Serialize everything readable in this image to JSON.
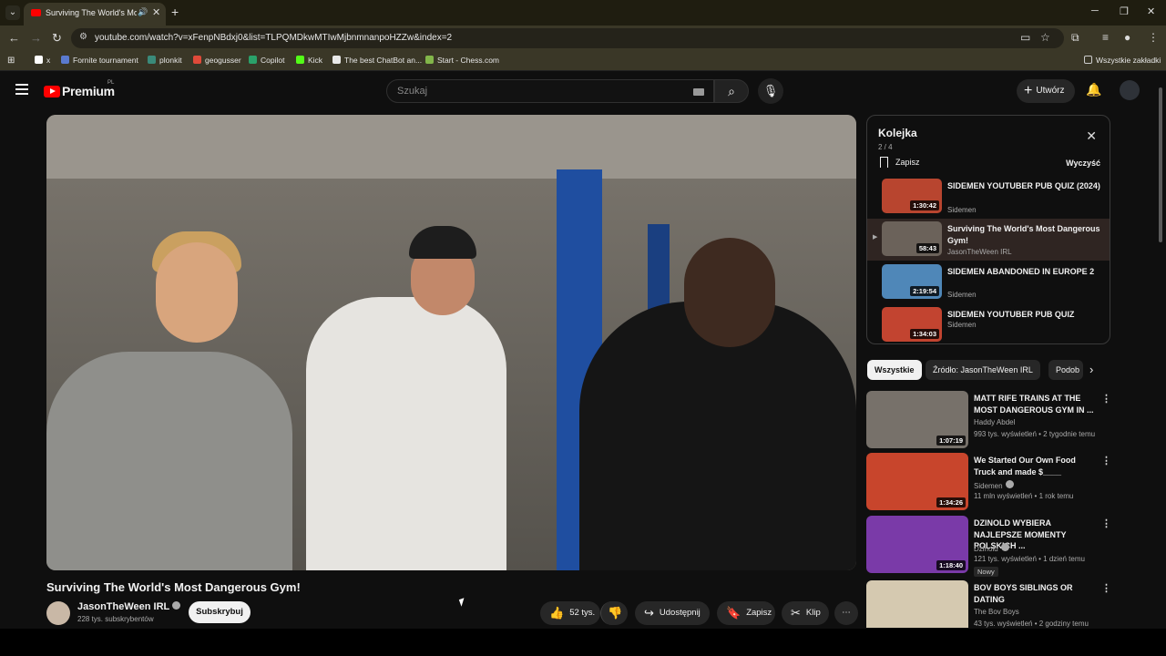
{
  "browser": {
    "tab_title": "Surviving The World's Most",
    "url": "youtube.com/watch?v=xFenpNBdxj0&list=TLPQMDkwMTIwMjbnmnanpoHZZw&index=2",
    "bookmarks": [
      "x",
      "Fornite tournament",
      "plonkit",
      "geogusser",
      "Copilot",
      "Kick",
      "The best ChatBot an...",
      "Start - Chess.com"
    ],
    "bookmark_colors": [
      "#ffffff",
      "#5a7acf",
      "#3a8a7a",
      "#e04a3a",
      "#2aa16a",
      "#53fc18",
      "#e8e8e8",
      "#82b64a"
    ],
    "all_bookmarks": "Wszystkie zakładki"
  },
  "header": {
    "logo": "Premium",
    "logo_region": "PL",
    "search_placeholder": "Szukaj",
    "create_label": "Utwórz"
  },
  "video": {
    "title": "Surviving The World's Most Dangerous Gym!",
    "channel": "JasonTheWeen IRL",
    "subscribers": "228 tys. subskrybentów",
    "subscribe_label": "Subskrybuj",
    "likes": "52 tys.",
    "share_label": "Udostępnij",
    "save_label": "Zapisz",
    "clip_label": "Klip"
  },
  "queue": {
    "title": "Kolejka",
    "position": "2 / 4",
    "save_label": "Zapisz",
    "clear_label": "Wyczyść",
    "items": [
      {
        "title": "SIDEMEN YOUTUBER PUB QUIZ (2024)",
        "channel": "Sidemen",
        "duration": "1:30:42",
        "color": "#b8452f"
      },
      {
        "title": "Surviving The World's Most Dangerous Gym!",
        "channel": "JasonTheWeen IRL",
        "duration": "58:43",
        "color": "#6b625a"
      },
      {
        "title": "SIDEMEN ABANDONED IN EUROPE 2",
        "channel": "Sidemen",
        "duration": "2:19:54",
        "color": "#4f87b8"
      },
      {
        "title": "SIDEMEN YOUTUBER PUB QUIZ",
        "channel": "Sidemen",
        "duration": "1:34:03",
        "color": "#c24430"
      }
    ]
  },
  "chips": [
    "Wszystkie",
    "Źródło: JasonTheWeen IRL",
    "Podob"
  ],
  "related": [
    {
      "title": "MATT RIFE TRAINS AT THE MOST DANGEROUS GYM IN ...",
      "channel": "Haddy Abdel",
      "meta": "993 tys. wyświetleń • 2 tygodnie temu",
      "duration": "1:07:19",
      "color": "#77716a",
      "new": ""
    },
    {
      "title": "We Started Our Own Food Truck and made $____",
      "channel": "Sidemen",
      "meta": "11 mln wyświetleń • 1 rok temu",
      "duration": "1:34:26",
      "color": "#c8452c",
      "new": ""
    },
    {
      "title": "DZINOLD WYBIERA NAJLEPSZE MOMENTY POLSKICH ...",
      "channel": "Dzinold",
      "meta": "121 tys. wyświetleń • 1 dzień temu",
      "duration": "1:18:40",
      "color": "#7a3aa8",
      "new": "Nowy"
    },
    {
      "title": "BOV BOYS SIBLINGS OR DATING",
      "channel": "The Bov Boys",
      "meta": "43 tys. wyświetleń • 2 godziny temu",
      "duration": "",
      "color": "#d5c9b0",
      "new": ""
    }
  ]
}
